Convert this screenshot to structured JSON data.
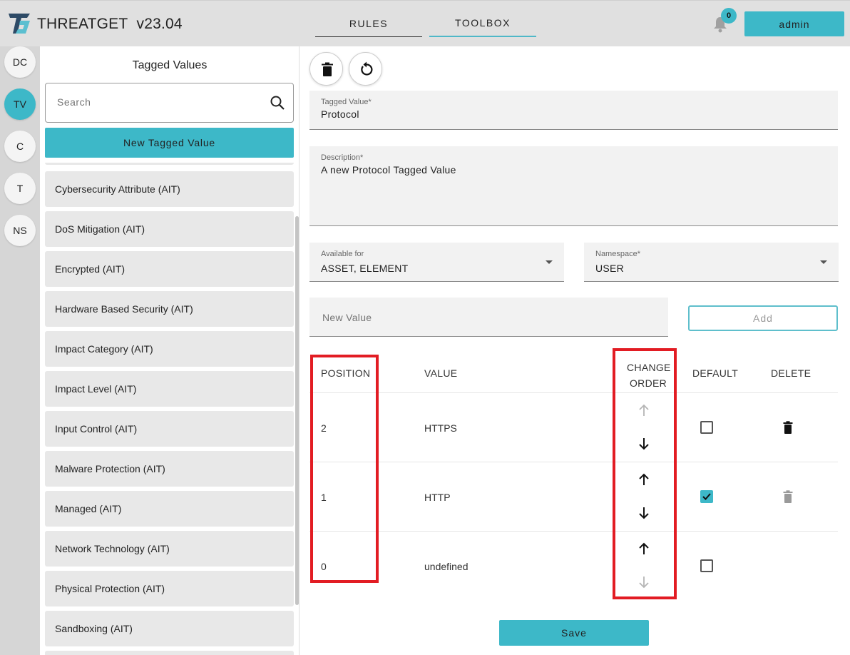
{
  "header": {
    "app_name": "THREATGET",
    "version": "v23.04",
    "tabs": [
      {
        "label": "RULES",
        "active": false
      },
      {
        "label": "TOOLBOX",
        "active": true
      }
    ],
    "notification_count": "0",
    "user_label": "admin"
  },
  "rail": {
    "items": [
      {
        "label": "DC",
        "active": false
      },
      {
        "label": "TV",
        "active": true
      },
      {
        "label": "C",
        "active": false
      },
      {
        "label": "T",
        "active": false
      },
      {
        "label": "NS",
        "active": false
      }
    ]
  },
  "list_panel": {
    "title": "Tagged Values",
    "search_placeholder": "Search",
    "new_button_label": "New Tagged Value",
    "items": [
      "Cybersecurity Attribute (AIT)",
      "DoS Mitigation (AIT)",
      "Encrypted (AIT)",
      "Hardware Based Security (AIT)",
      "Impact Category (AIT)",
      "Impact Level (AIT)",
      "Input Control (AIT)",
      "Malware Protection (AIT)",
      "Managed (AIT)",
      "Network Technology (AIT)",
      "Physical Protection (AIT)",
      "Sandboxing (AIT)"
    ]
  },
  "detail": {
    "tagged_value": {
      "label": "Tagged Value*",
      "value": "Protocol"
    },
    "description": {
      "label": "Description*",
      "value": "A new Protocol Tagged Value"
    },
    "available_for": {
      "label": "Available for",
      "value": "ASSET, ELEMENT"
    },
    "namespace": {
      "label": "Namespace*",
      "value": "USER"
    },
    "new_value_placeholder": "New Value",
    "add_button_label": "Add",
    "table": {
      "headers": {
        "position": "POSITION",
        "value": "VALUE",
        "change_order_line1": "CHANGE",
        "change_order_line2": "ORDER",
        "default": "DEFAULT",
        "delete": "DELETE"
      },
      "rows": [
        {
          "position": "2",
          "value": "HTTPS",
          "default": false
        },
        {
          "position": "1",
          "value": "HTTP",
          "default": true
        },
        {
          "position": "0",
          "value": "undefined",
          "default": false
        }
      ]
    },
    "save_button_label": "Save"
  },
  "colors": {
    "accent": "#3db8c8",
    "highlight": "#e21c23"
  }
}
